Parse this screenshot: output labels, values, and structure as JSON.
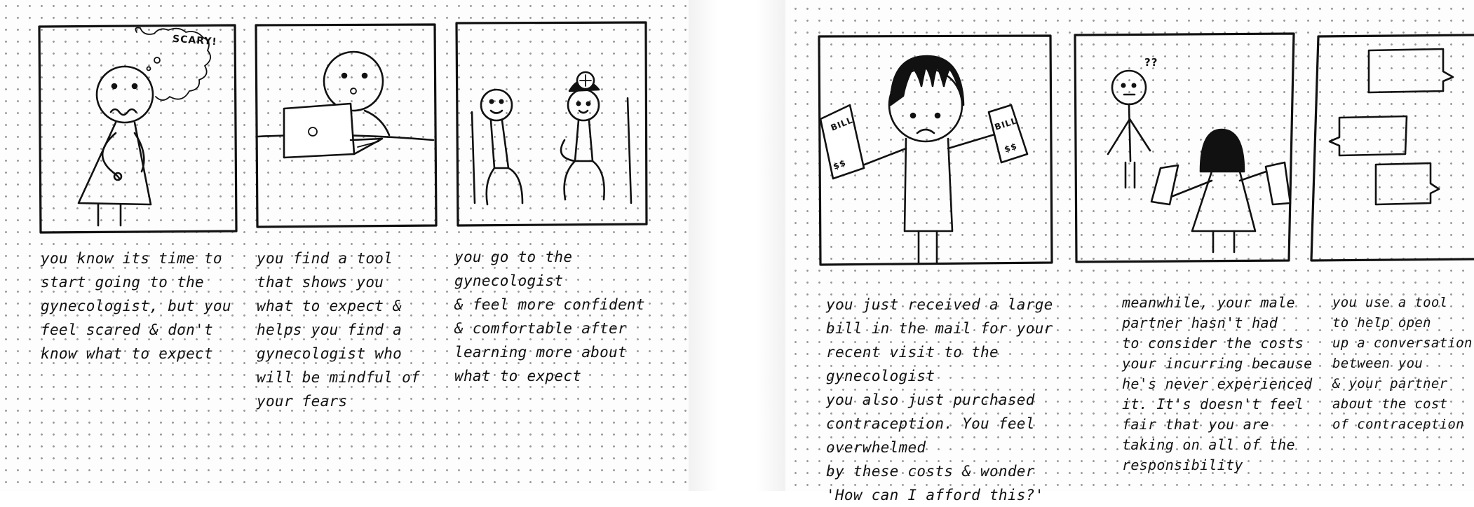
{
  "panels": {
    "p1": {
      "thought_text": "SCARY!",
      "caption": "you know its time to\nstart going to the\ngynecologist, but you\nfeel scared & don't\nknow what to expect"
    },
    "p2": {
      "caption": "you find a tool\nthat shows you\nwhat to expect &\nhelps you find a\ngynecologist who\nwill be mindful of\nyour fears"
    },
    "p3": {
      "caption": "you go to the gynecologist\n& feel more confident\n& comfortable after\nlearning more about\nwhat to expect"
    },
    "p4": {
      "bill_left_text": "BILL",
      "money_left_text": "$$",
      "bill_right_text": "BILL",
      "money_right_text": "$$",
      "caption": "you just received a large\nbill in the mail for your\nrecent visit to the gynecologist\nyou also just purchased\ncontraception. You feel overwhelmed\nby these costs & wonder\n'How can I afford this?'"
    },
    "p5": {
      "confused_text": "??",
      "caption": "meanwhile, your male\npartner hasn't had\nto consider the costs\nyour incurring because\nhe's never experienced\nit. It's doesn't feel\nfair that you are\ntaking on all of the\nresponsibility"
    },
    "p6": {
      "caption": "you use a tool\nto help open\nup a conversation\nbetween you\n& your partner\nabout the cost\nof contraception"
    }
  }
}
